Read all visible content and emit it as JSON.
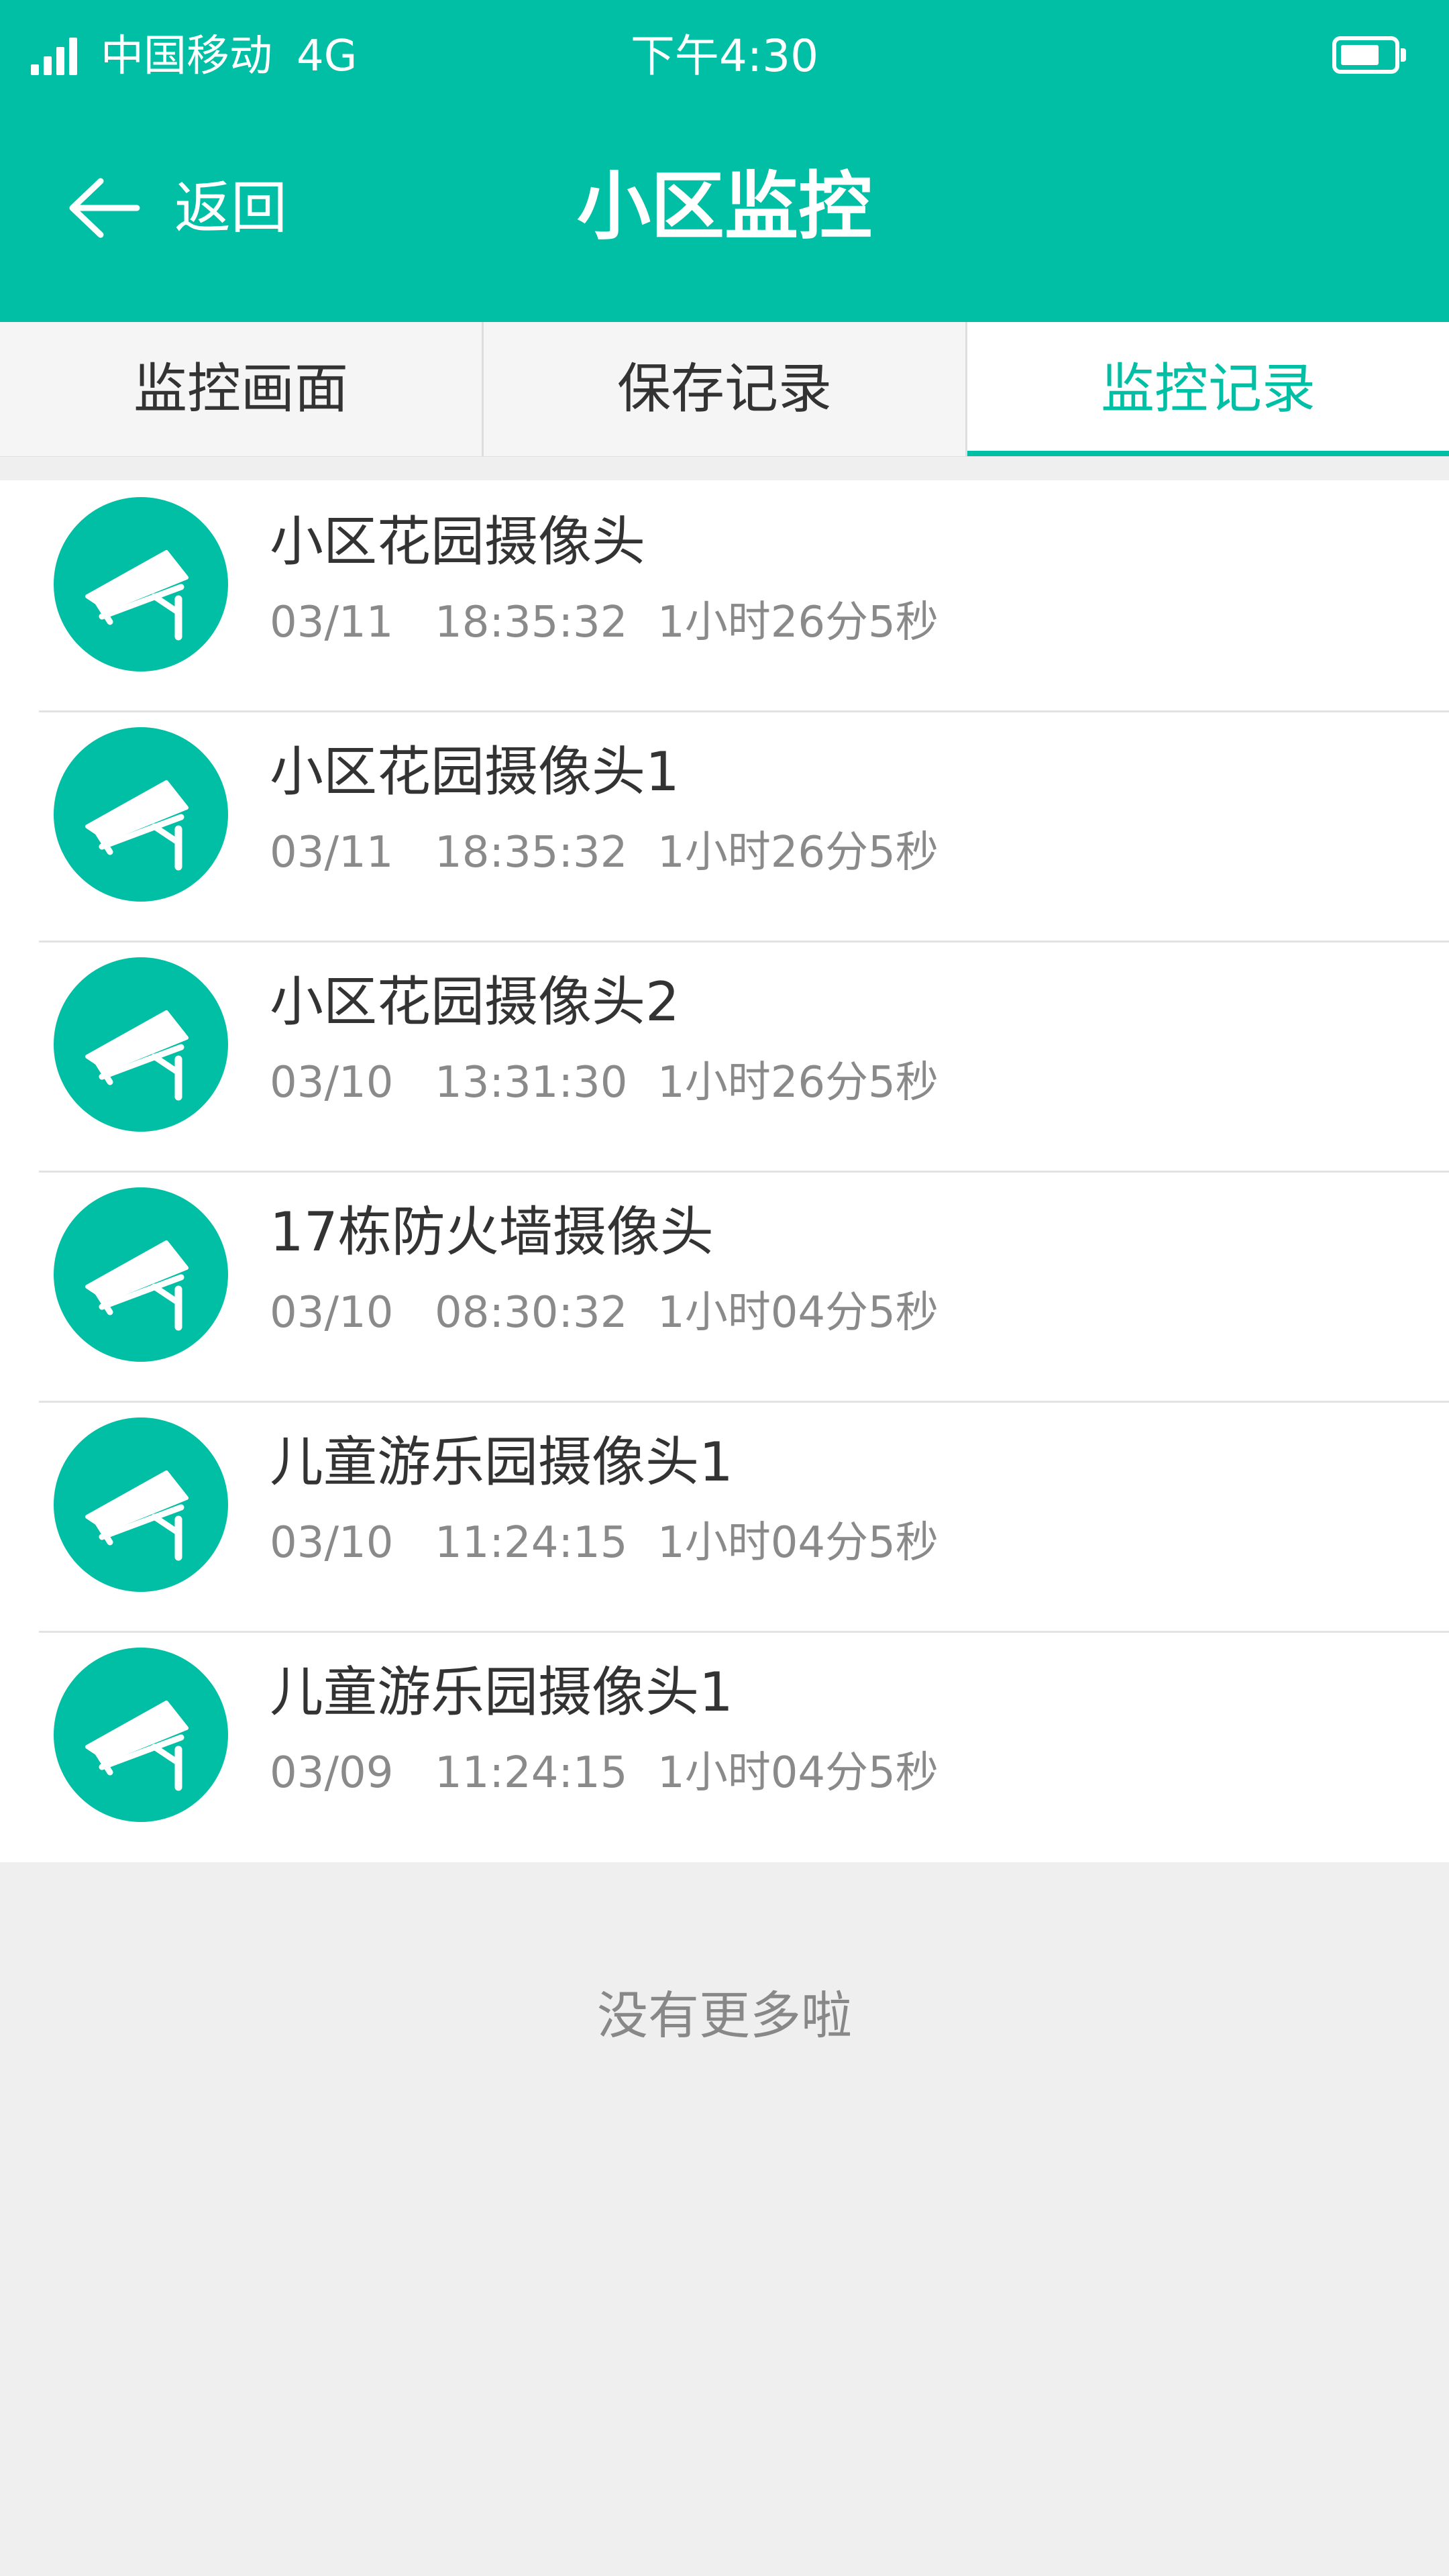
{
  "status_bar": {
    "carrier": "中国移动",
    "network": "4G",
    "time": "下午4:30",
    "signal_icon": "signal-bars-icon",
    "battery_icon": "battery-icon",
    "battery_level": 0.75
  },
  "nav": {
    "back_label": "返回",
    "back_icon": "arrow-left-icon",
    "title": "小区监控"
  },
  "tabs": [
    {
      "label": "监控画面",
      "active": false
    },
    {
      "label": "保存记录",
      "active": false
    },
    {
      "label": "监控记录",
      "active": true
    }
  ],
  "records": [
    {
      "name": "小区花园摄像头",
      "date": "03/11",
      "time": "18:35:32",
      "duration": "1小时26分5秒",
      "icon": "cctv-camera-icon"
    },
    {
      "name": "小区花园摄像头1",
      "date": "03/11",
      "time": "18:35:32",
      "duration": "1小时26分5秒",
      "icon": "cctv-camera-icon"
    },
    {
      "name": "小区花园摄像头2",
      "date": "03/10",
      "time": "13:31:30",
      "duration": "1小时26分5秒",
      "icon": "cctv-camera-icon"
    },
    {
      "name": "17栋防火墙摄像头",
      "date": "03/10",
      "time": "08:30:32",
      "duration": "1小时04分5秒",
      "icon": "cctv-camera-icon"
    },
    {
      "name": "儿童游乐园摄像头1",
      "date": "03/10",
      "time": "11:24:15",
      "duration": "1小时04分5秒",
      "icon": "cctv-camera-icon"
    },
    {
      "name": "儿童游乐园摄像头1",
      "date": "03/09",
      "time": "11:24:15",
      "duration": "1小时04分5秒",
      "icon": "cctv-camera-icon"
    }
  ],
  "footer": {
    "no_more_text": "没有更多啦"
  },
  "colors": {
    "accent": "#00bfa5",
    "background": "#efefef",
    "text_primary": "#333333",
    "text_secondary": "#8a8a8a"
  }
}
